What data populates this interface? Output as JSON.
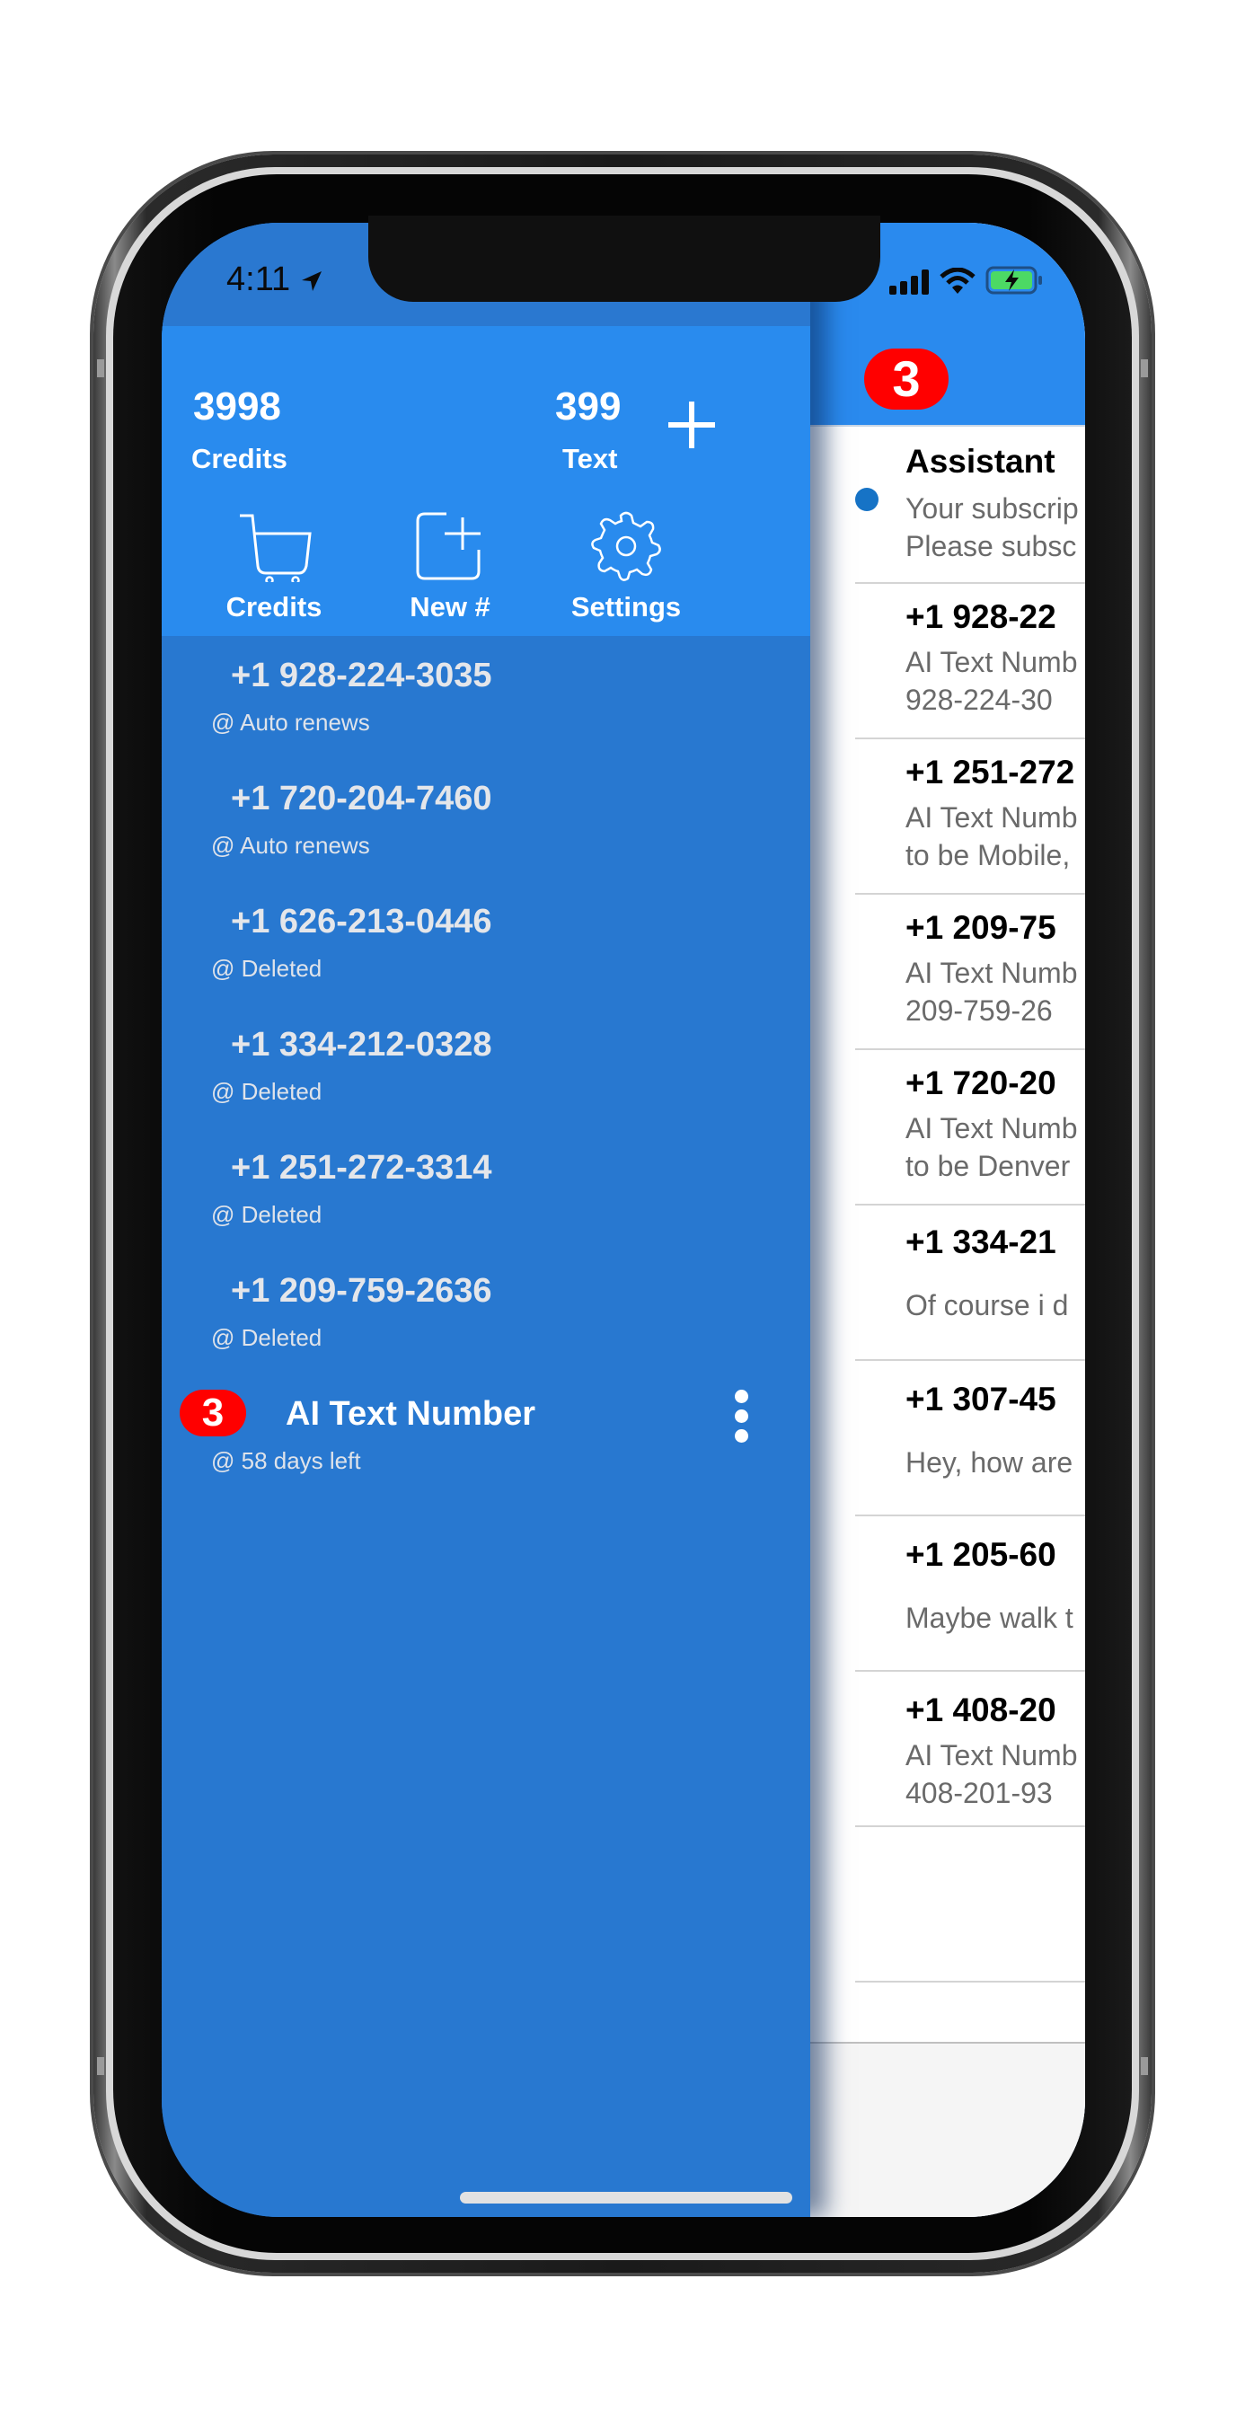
{
  "status_bar": {
    "time": "4:11",
    "location_icon": "location-arrow-icon",
    "signal_icon": "cellular-signal-icon",
    "wifi_icon": "wifi-icon",
    "battery_icon": "battery-charging-icon",
    "battery_color": "#4cd964"
  },
  "drawer": {
    "credits_value": "3998",
    "credits_label": "Credits",
    "text_value": "399",
    "text_label": "Text",
    "add_icon": "plus-icon",
    "actions": [
      {
        "label": "Credits",
        "icon": "shopping-cart-icon"
      },
      {
        "label": "New #",
        "icon": "new-number-icon"
      },
      {
        "label": "Settings",
        "icon": "gear-icon"
      }
    ],
    "numbers": [
      {
        "phone": "+1 928-224-3035",
        "status": "@ Auto renews"
      },
      {
        "phone": "+1 720-204-7460",
        "status": "@ Auto renews"
      },
      {
        "phone": "+1 626-213-0446",
        "status": "@ Deleted"
      },
      {
        "phone": "+1 334-212-0328",
        "status": "@ Deleted"
      },
      {
        "phone": "+1 251-272-3314",
        "status": "@ Deleted"
      },
      {
        "phone": "+1 209-759-2636",
        "status": "@ Deleted"
      }
    ],
    "active_number": {
      "badge": "3",
      "title": "AI Text Number",
      "status": "@ 58 days left",
      "menu_icon": "more-vertical-icon"
    }
  },
  "colors": {
    "drawer_bg": "#2878d0",
    "header_bg": "#298bee",
    "badge_red": "#ff0000",
    "unread_dot": "#1673c6"
  },
  "conversations": {
    "header_badge": "3",
    "items": [
      {
        "name": "Assistant",
        "preview": "Your subscrip\nPlease subsc",
        "unread": true
      },
      {
        "name": "+1 928-22",
        "preview": "AI Text Numb\n928-224-30",
        "unread": false
      },
      {
        "name": "+1 251-272",
        "preview": "AI Text Numb\nto be Mobile,",
        "unread": false
      },
      {
        "name": "+1 209-75",
        "preview": "AI Text Numb\n209-759-26",
        "unread": false
      },
      {
        "name": "+1 720-20",
        "preview": "AI Text Numb\nto be Denver",
        "unread": false
      },
      {
        "name": "+1 334-21",
        "preview": "Of course i d",
        "unread": false
      },
      {
        "name": "+1 307-45",
        "preview": "Hey, how are",
        "unread": false
      },
      {
        "name": "+1 205-60",
        "preview": "Maybe walk t",
        "unread": false
      },
      {
        "name": "+1 408-20",
        "preview": "AI Text Numb\n408-201-93",
        "unread": false
      }
    ]
  }
}
